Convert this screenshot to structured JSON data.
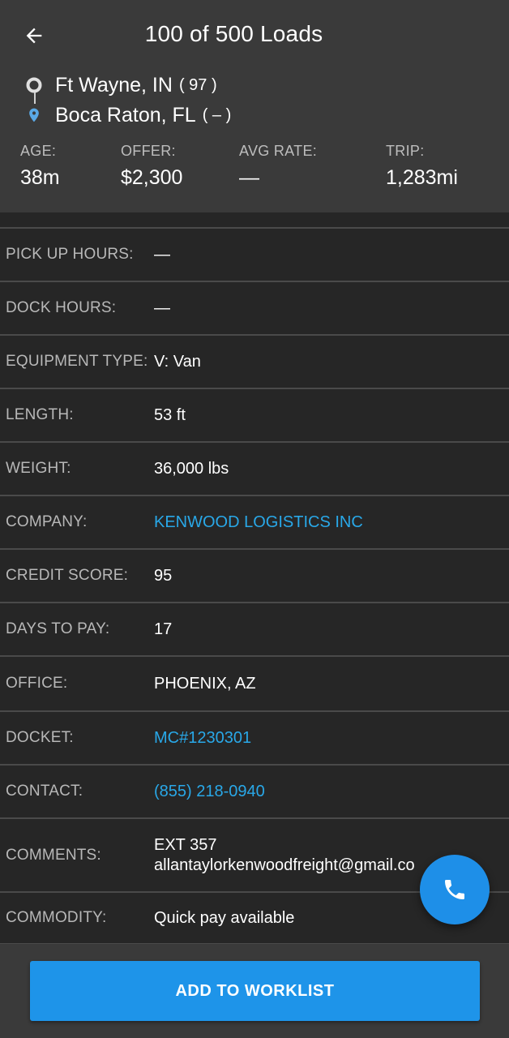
{
  "header": {
    "title": "100 of 500 Loads",
    "back_icon": "arrow-left-icon",
    "origin": {
      "city": "Ft Wayne, IN",
      "extra": "( 97 )",
      "icon": "circle-outline-icon"
    },
    "destination": {
      "city": "Boca Raton, FL",
      "extra": "( – )",
      "icon": "map-pin-icon",
      "icon_color": "#5aa9e6"
    },
    "stats": {
      "age": {
        "label": "AGE:",
        "value": "38m"
      },
      "offer": {
        "label": "OFFER:",
        "value": "$2,300"
      },
      "avg_rate": {
        "label": "AVG RATE:",
        "value": "—"
      },
      "trip": {
        "label": "TRIP:",
        "value": "1,283mi"
      }
    }
  },
  "details": [
    {
      "label": "PICK UP HOURS:",
      "value": "—"
    },
    {
      "label": "DOCK HOURS:",
      "value": "—"
    },
    {
      "label": "EQUIPMENT TYPE:",
      "value": "V: Van"
    },
    {
      "label": "LENGTH:",
      "value": "53 ft"
    },
    {
      "label": "WEIGHT:",
      "value": "36,000 lbs"
    },
    {
      "label": "COMPANY:",
      "value": "KENWOOD LOGISTICS INC",
      "link": true
    },
    {
      "label": "CREDIT SCORE:",
      "value": "95"
    },
    {
      "label": "DAYS TO PAY:",
      "value": "17"
    },
    {
      "label": "OFFICE:",
      "value": "PHOENIX, AZ"
    },
    {
      "label": "DOCKET:",
      "value": "MC#1230301",
      "link": true
    },
    {
      "label": "CONTACT:",
      "value": "(855) 218-0940",
      "link": true
    },
    {
      "label": "COMMENTS:",
      "value_line1": "EXT 357",
      "value_line2": "allantaylorkenwoodfreight@gmail.co"
    },
    {
      "label": "COMMODITY:",
      "value": "Quick pay available"
    }
  ],
  "fab": {
    "icon": "phone-icon"
  },
  "cta": {
    "label": "ADD TO WORKLIST"
  },
  "colors": {
    "header_bg": "#3a3a3a",
    "page_bg": "#262626",
    "link": "#29a8e8",
    "accent": "#1e94e9"
  }
}
